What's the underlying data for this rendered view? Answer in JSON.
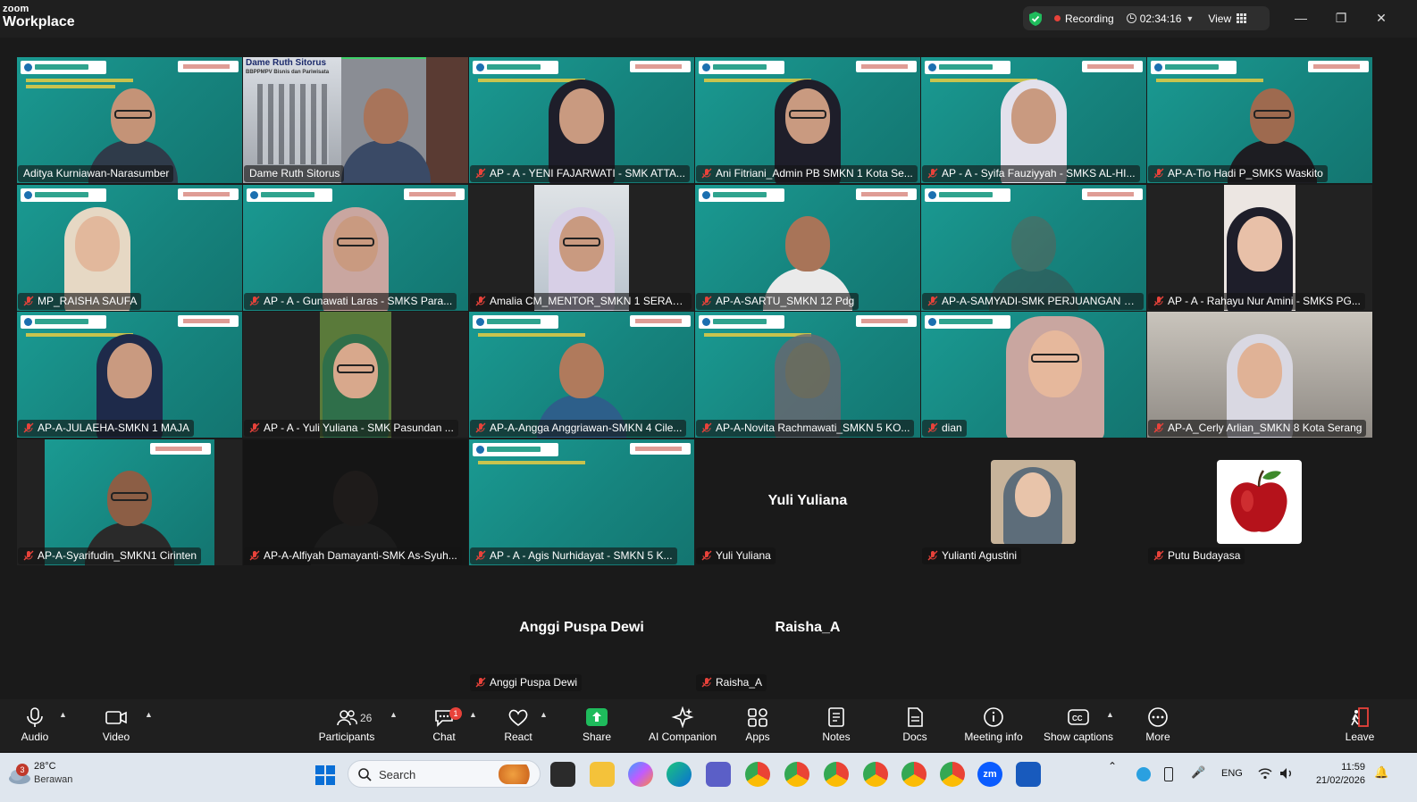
{
  "app": {
    "brand_small": "zoom",
    "brand_big": "Workplace"
  },
  "topbar": {
    "recording_label": "Recording",
    "timer": "02:34:16",
    "view_label": "View"
  },
  "tiles": [
    {
      "name": "Aditya Kurniawan-Narasumber",
      "muted": false
    },
    {
      "name": "Dame Ruth Sitorus",
      "muted": false,
      "overlay_title": "Dame Ruth Sitorus",
      "overlay_sub": "BBPPMPV Bisnis dan Pariwisata"
    },
    {
      "name": "AP - A  - YENI FAJARWATI - SMK ATTA...",
      "muted": true
    },
    {
      "name": "Ani Fitriani_Admin PB SMKN 1 Kota Se...",
      "muted": true
    },
    {
      "name": "AP - A - Syifa Fauziyyah - SMKS AL-HI...",
      "muted": true
    },
    {
      "name": "AP-A-Tio Hadi P_SMKS Waskito",
      "muted": true
    },
    {
      "name": "MP_RAISHA SAUFA",
      "muted": true
    },
    {
      "name": "AP - A - Gunawati Laras - SMKS Para...",
      "muted": true
    },
    {
      "name": "Amalia CM_MENTOR_SMKN 1 SERANG",
      "muted": true
    },
    {
      "name": "AP-A-SARTU_SMKN 12 Pdg",
      "muted": true
    },
    {
      "name": "AP-A-SAMYADI-SMK PERJUANGAN BA...",
      "muted": true
    },
    {
      "name": "AP - A - Rahayu Nur Amini - SMKS PG...",
      "muted": true
    },
    {
      "name": "AP-A-JULAEHA-SMKN 1 MAJA",
      "muted": true
    },
    {
      "name": "AP - A - Yuli Yuliana - SMK Pasundan ...",
      "muted": true
    },
    {
      "name": "AP-A-Angga Anggriawan-SMKN 4 Cile...",
      "muted": true
    },
    {
      "name": "AP-A-Novita Rachmawati_SMKN 5 KO...",
      "muted": true
    },
    {
      "name": "dian",
      "muted": true
    },
    {
      "name": "AP-A_Cerly Arlian_SMKN 8 Kota Serang",
      "muted": true
    },
    {
      "name": "AP-A-Syarifudin_SMKN1 Cirinten",
      "muted": true
    },
    {
      "name": "AP-A-Alfiyah Damayanti-SMK As-Syuh...",
      "muted": true
    },
    {
      "name": "AP - A - Agis Nurhidayat - SMKN 5 K...",
      "muted": true
    },
    {
      "name": "Yuli Yuliana",
      "muted": true,
      "big": "Yuli Yuliana"
    },
    {
      "name": "Yulianti Agustini",
      "muted": true
    },
    {
      "name": "Putu Budayasa",
      "muted": true
    },
    {
      "name": "Anggi Puspa Dewi",
      "muted": true,
      "big": "Anggi Puspa Dewi"
    },
    {
      "name": "Raisha_A",
      "muted": true,
      "big": "Raisha_A"
    }
  ],
  "toolbar": {
    "audio": "Audio",
    "video": "Video",
    "participants": "Participants",
    "participants_count": "26",
    "chat": "Chat",
    "chat_badge": "1",
    "react": "React",
    "share": "Share",
    "ai_companion": "AI Companion",
    "apps": "Apps",
    "notes": "Notes",
    "docs": "Docs",
    "meeting_info": "Meeting info",
    "captions": "Show captions",
    "more": "More",
    "leave": "Leave"
  },
  "taskbar": {
    "weather_badge": "3",
    "temp": "28°C",
    "condition": "Berawan",
    "search_placeholder": "Search",
    "lang": "ENG",
    "time": "11:59",
    "date": "21/02/2026"
  },
  "colors": {
    "accent": "#0e72ed",
    "share": "#1fbb5c",
    "muted": "#e8423a",
    "active_border": "#3fd16a",
    "teal_bg": "#16847e"
  }
}
